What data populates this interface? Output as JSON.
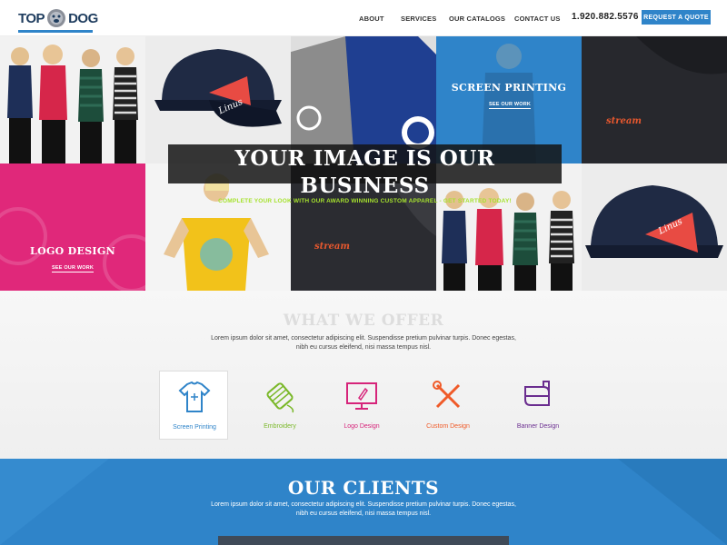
{
  "header": {
    "logo_left": "TOP",
    "logo_right": "DOG",
    "nav": [
      "ABOUT",
      "SERVICES",
      "OUR CATALOGS",
      "CONTACT US"
    ],
    "phone": "1.920.882.5576",
    "cta": "REQUEST A QUOTE"
  },
  "hero": {
    "title": "YOUR IMAGE IS OUR BUSINESS",
    "subtitle": "COMPLETE YOUR LOOK WITH OUR AWARD WINNING CUSTOM APPAREL - GET STARTED TODAY!",
    "screen_printing": {
      "label": "SCREEN PRINTING",
      "link": "SEE OUR WORK"
    },
    "logo_design": {
      "label": "LOGO DESIGN",
      "link": "SEE OUR WORK"
    },
    "cap_patch_text": "Linus",
    "shirt_text": "stream"
  },
  "offer": {
    "title": "WHAT WE OFFER",
    "lorem_line1": "Lorem ipsum dolor sit amet, consectetur adipiscing elit. Suspendisse pretium pulvinar turpis. Donec egestas,",
    "lorem_line2": "nibh eu cursus eleifend, nisi massa tempus nisl.",
    "services": [
      {
        "label": "Screen Printing",
        "icon": "tshirt-icon",
        "color": "#2f84c9"
      },
      {
        "label": "Embroidery",
        "icon": "thread-spool-icon",
        "color": "#7ab829"
      },
      {
        "label": "Logo Design",
        "icon": "monitor-pen-icon",
        "color": "#d6247a"
      },
      {
        "label": "Custom Design",
        "icon": "wrench-pencil-icon",
        "color": "#f05a28"
      },
      {
        "label": "Banner Design",
        "icon": "banner-icon",
        "color": "#6a2d8f"
      }
    ]
  },
  "clients": {
    "title": "OUR CLIENTS",
    "lorem_line1": "Lorem ipsum dolor sit amet, consectetur adipiscing elit. Suspendisse pretium pulvinar turpis. Donec egestas,",
    "lorem_line2": "nibh eu cursus eleifend, nisi massa tempus nisl."
  },
  "colors": {
    "brand_blue": "#2f84c9",
    "navy": "#1e3c5e",
    "pink": "#e0287a",
    "lime": "#a6e22e"
  }
}
